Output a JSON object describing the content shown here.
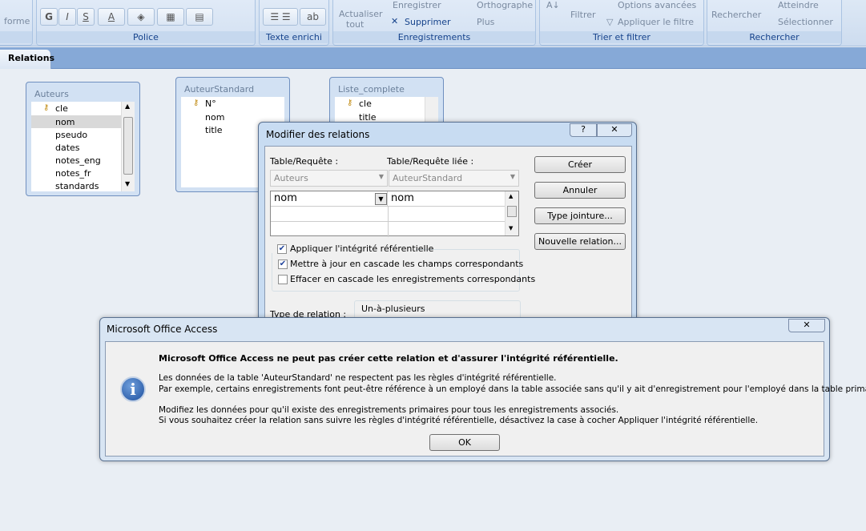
{
  "ribbon": {
    "groups": [
      {
        "label": ""
      },
      {
        "label": "Police"
      },
      {
        "label": "Texte enrichi"
      },
      {
        "label": "Enregistrements"
      },
      {
        "label": "Trier et filtrer"
      },
      {
        "label": "Rechercher"
      }
    ],
    "forme_partial": "forme",
    "police_buttons": [
      "G",
      "I",
      "S",
      "A"
    ],
    "actualiser": "Actualiser",
    "tout": "tout",
    "enregistrer": "Enregistrer",
    "supprimer": "Supprimer",
    "orthographe": "Orthographe",
    "plus": "Plus",
    "filtrer": "Filtrer",
    "options_avancees": "Options avancées",
    "appliquer_filtre": "Appliquer le filtre",
    "rechercher": "Rechercher",
    "atteindre": "Atteindre",
    "selectionner": "Sélectionner"
  },
  "tab": {
    "label": "Relations"
  },
  "tables": {
    "auteurs": {
      "title": "Auteurs",
      "fields": [
        "cle",
        "nom",
        "pseudo",
        "dates",
        "notes_eng",
        "notes_fr",
        "standards"
      ]
    },
    "auteur_standard": {
      "title": "AuteurStandard",
      "fields": [
        "N°",
        "nom",
        "title"
      ]
    },
    "liste_complete": {
      "title": "Liste_complete",
      "fields": [
        "cle",
        "title"
      ]
    }
  },
  "relations_dialog": {
    "title": "Modifier des relations",
    "help": "?",
    "close": "✕",
    "table_label": "Table/Requête :",
    "linked_label": "Table/Requête liée :",
    "table_value": "Auteurs",
    "linked_value": "AuteurStandard",
    "grid": [
      [
        "nom",
        "nom"
      ]
    ],
    "checkboxes": [
      {
        "label": "Appliquer l'intégrité référentielle",
        "checked": true
      },
      {
        "label": "Mettre à jour en cascade les champs correspondants",
        "checked": true
      },
      {
        "label": "Effacer en cascade les enregistrements correspondants",
        "checked": false
      }
    ],
    "type_label": "Type de relation :",
    "type_value": "Un-à-plusieurs",
    "buttons": {
      "create": "Créer",
      "cancel": "Annuler",
      "join": "Type jointure...",
      "new": "Nouvelle relation..."
    }
  },
  "message_box": {
    "title": "Microsoft Office Access",
    "close": "✕",
    "heading": "Microsoft Office Access ne peut pas créer cette relation et d'assurer l'intégrité référentielle.",
    "lines": [
      "Les données de la table 'AuteurStandard' ne respectent pas les règles d'intégrité référentielle.",
      "Par exemple, certains enregistrements font peut-être référence à un employé dans la table associée sans qu'il y ait d'enregistrement pour l'employé dans la table primaire.",
      "Modifiez les données pour qu'il existe des enregistrements primaires pour tous les enregistrements associés.",
      "Si vous souhaitez créer la relation sans suivre les règles d'intégrité référentielle, désactivez la case à cocher Appliquer l'intégrité référentielle."
    ],
    "ok": "OK",
    "icon_glyph": "i"
  }
}
